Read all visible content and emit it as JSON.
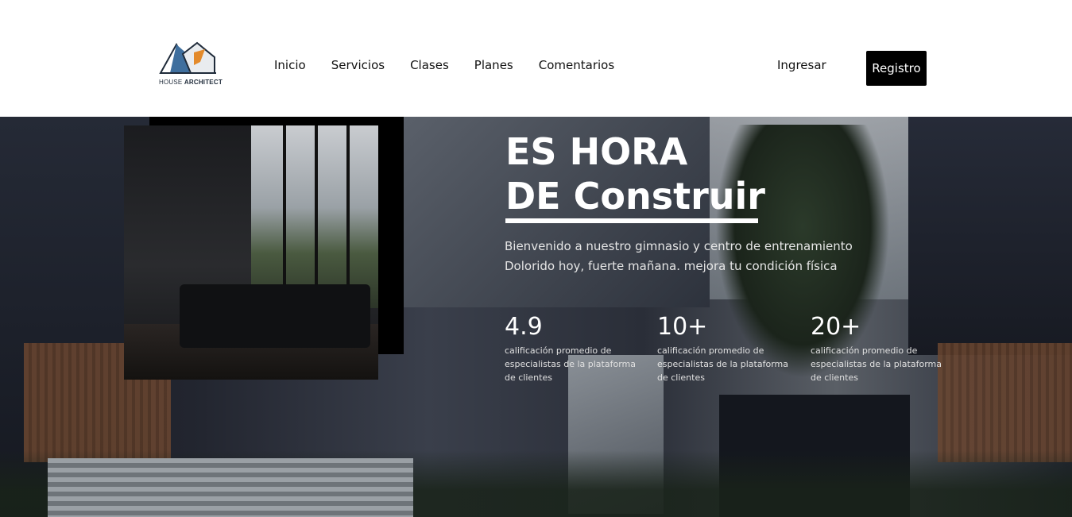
{
  "brand": {
    "logo_text_light": "HOUSE",
    "logo_text_bold": "ARCHITECT",
    "accent_color": "#e38a2b",
    "primary_color": "#3f6f9e"
  },
  "nav": {
    "items": [
      "Inicio",
      "Servicios",
      "Clases",
      "Planes",
      "Comentarios"
    ],
    "login_label": "Ingresar",
    "register_label": "Registro"
  },
  "hero": {
    "headline_line1": "ES HORA",
    "headline_line2": "DE Construir",
    "subtitle_line1": "Bienvenido a nuestro gimnasio y centro de entrenamiento",
    "subtitle_line2": "Dolorido hoy, fuerte mañana. mejora tu condición física",
    "stats": [
      {
        "value": "4.9",
        "description": "calificación promedio de especialistas de la plataforma de clientes"
      },
      {
        "value": "10+",
        "description": "calificación promedio de especialistas de la plataforma de clientes"
      },
      {
        "value": "20+",
        "description": "calificación promedio de especialistas de la plataforma de clientes"
      }
    ]
  }
}
